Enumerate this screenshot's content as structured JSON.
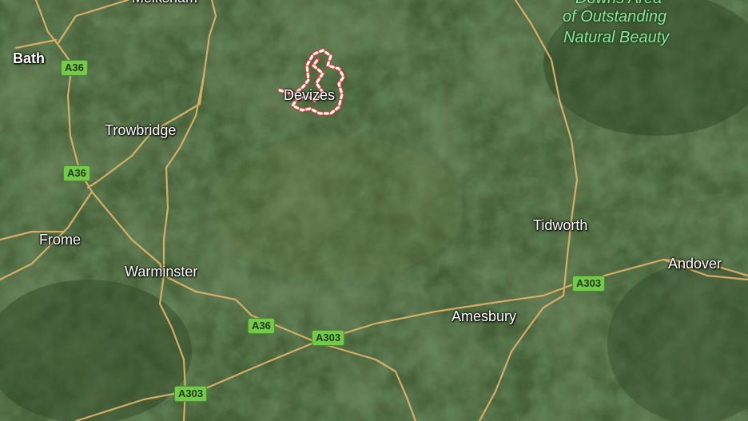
{
  "map": {
    "type": "satellite",
    "colors": {
      "terrain": "#3f5a32",
      "road": "#e0b36a",
      "route_stroke": "#e8352b",
      "route_dash": "#ffffff",
      "shield_bg": "#74c94a",
      "area_text": "#8fe39a"
    }
  },
  "places": {
    "bath": "Bath",
    "trowbridge": "Trowbridge",
    "frome": "Frome",
    "warminster": "Warminster",
    "devizes": "Devizes",
    "tidworth": "Tidworth",
    "amesbury": "Amesbury",
    "andover": "Andover",
    "top_cut": "Melksham"
  },
  "area": {
    "line1": "Downs Area",
    "line2": "of Outstanding",
    "line3": "Natural Beauty"
  },
  "roads": {
    "a36_bath": "A36",
    "a36_trowbridge": "A36",
    "a36_south": "A36",
    "a303_west": "A303",
    "a303_centre": "A303",
    "a303_east": "A303"
  }
}
